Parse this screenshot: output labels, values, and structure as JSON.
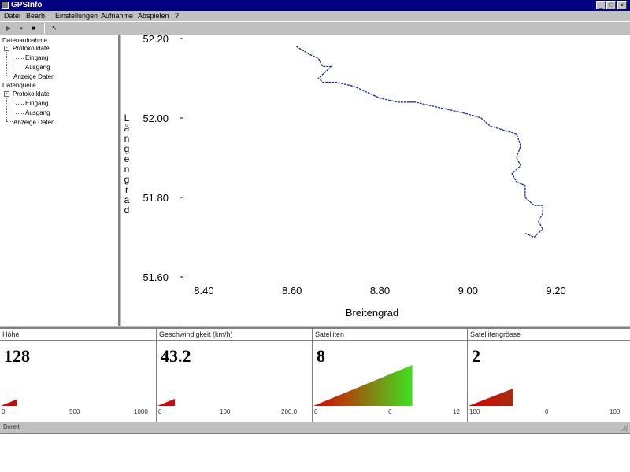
{
  "window": {
    "title": "GPSInfo",
    "minimize_glyph": "_",
    "maximize_glyph": "□",
    "close_glyph": "×"
  },
  "menubar": {
    "items": [
      "Datei",
      "Bearb.",
      "Einstellungen",
      "Aufnahme",
      "Abspielen",
      "?"
    ]
  },
  "toolbar": {
    "buttons": [
      {
        "icon": "play-icon",
        "glyph": "▶"
      },
      {
        "icon": "record-icon",
        "glyph": "●"
      },
      {
        "icon": "stop-icon",
        "glyph": "■"
      },
      {
        "icon": "pointer-icon",
        "glyph": "↖"
      }
    ]
  },
  "tree": {
    "groups": [
      {
        "label": "Datenaufnahme",
        "children": [
          {
            "label": "Protokolldatei",
            "expander": "-",
            "children": [
              "Eingang",
              "Ausgang"
            ]
          },
          {
            "label": "Anzeige Daten"
          }
        ]
      },
      {
        "label": "Datenquelle",
        "children": [
          {
            "label": "Protokolldatei",
            "expander": "-",
            "children": [
              "Eingang",
              "Ausgang"
            ]
          },
          {
            "label": "Anzeige Daten"
          }
        ]
      }
    ]
  },
  "chart_data": {
    "type": "line",
    "xlabel": "Breitengrad",
    "ylabel": "Längengrad",
    "xlim": [
      8.35,
      9.25
    ],
    "ylim": [
      51.6,
      52.2
    ],
    "x_ticks": [
      "8.40",
      "8.60",
      "8.80",
      "9.00",
      "9.20"
    ],
    "x_tick_values": [
      8.4,
      8.6,
      8.8,
      9.0,
      9.2
    ],
    "y_ticks": [
      "52.20",
      "52.00",
      "51.80",
      "51.60"
    ],
    "y_tick_values": [
      52.2,
      52.0,
      51.8,
      51.6
    ],
    "grid": false,
    "line_color": "#1c2d8f",
    "series": [
      {
        "x": [
          8.61,
          8.64,
          8.66,
          8.67,
          8.69,
          8.67,
          8.66,
          8.67,
          8.7,
          8.74,
          8.78,
          8.8,
          8.84,
          8.88,
          8.92,
          8.96,
          9.0,
          9.03,
          9.05,
          9.08,
          9.11,
          9.12,
          9.11,
          9.12,
          9.1,
          9.11,
          9.13,
          9.13,
          9.15,
          9.17,
          9.17,
          9.16,
          9.17,
          9.15,
          9.13
        ],
        "y": [
          52.18,
          52.16,
          52.15,
          52.13,
          52.13,
          52.11,
          52.1,
          52.09,
          52.09,
          52.08,
          52.06,
          52.05,
          52.04,
          52.04,
          52.03,
          52.02,
          52.01,
          52.0,
          51.98,
          51.97,
          51.96,
          51.93,
          51.9,
          51.88,
          51.86,
          51.84,
          51.83,
          51.8,
          51.78,
          51.78,
          51.76,
          51.74,
          51.72,
          51.7,
          51.71
        ]
      }
    ]
  },
  "panels": [
    {
      "header": "Höhe",
      "value": "128",
      "ticks": [
        "0",
        "500",
        "1000"
      ],
      "fill": 0.13,
      "colors": [
        "#e00000",
        "#c01010"
      ]
    },
    {
      "header": "Geschwindigkeit (km/h)",
      "value": "43.2",
      "ticks": [
        "0",
        "100",
        "200.0"
      ],
      "fill": 0.14,
      "colors": [
        "#e00000",
        "#c01010"
      ]
    },
    {
      "header": "Satelliten",
      "value": "8",
      "ticks": [
        "0",
        "6",
        "12"
      ],
      "fill": 0.8,
      "colors": [
        "#e00000",
        "#40e020"
      ]
    },
    {
      "header": "Satellitengrösse",
      "value": "2",
      "ticks": [
        "100",
        "0",
        "100"
      ],
      "fill": 0.34,
      "colors": [
        "#e00000",
        "#a03010"
      ]
    }
  ],
  "statusbar": {
    "text": "Bereit"
  }
}
